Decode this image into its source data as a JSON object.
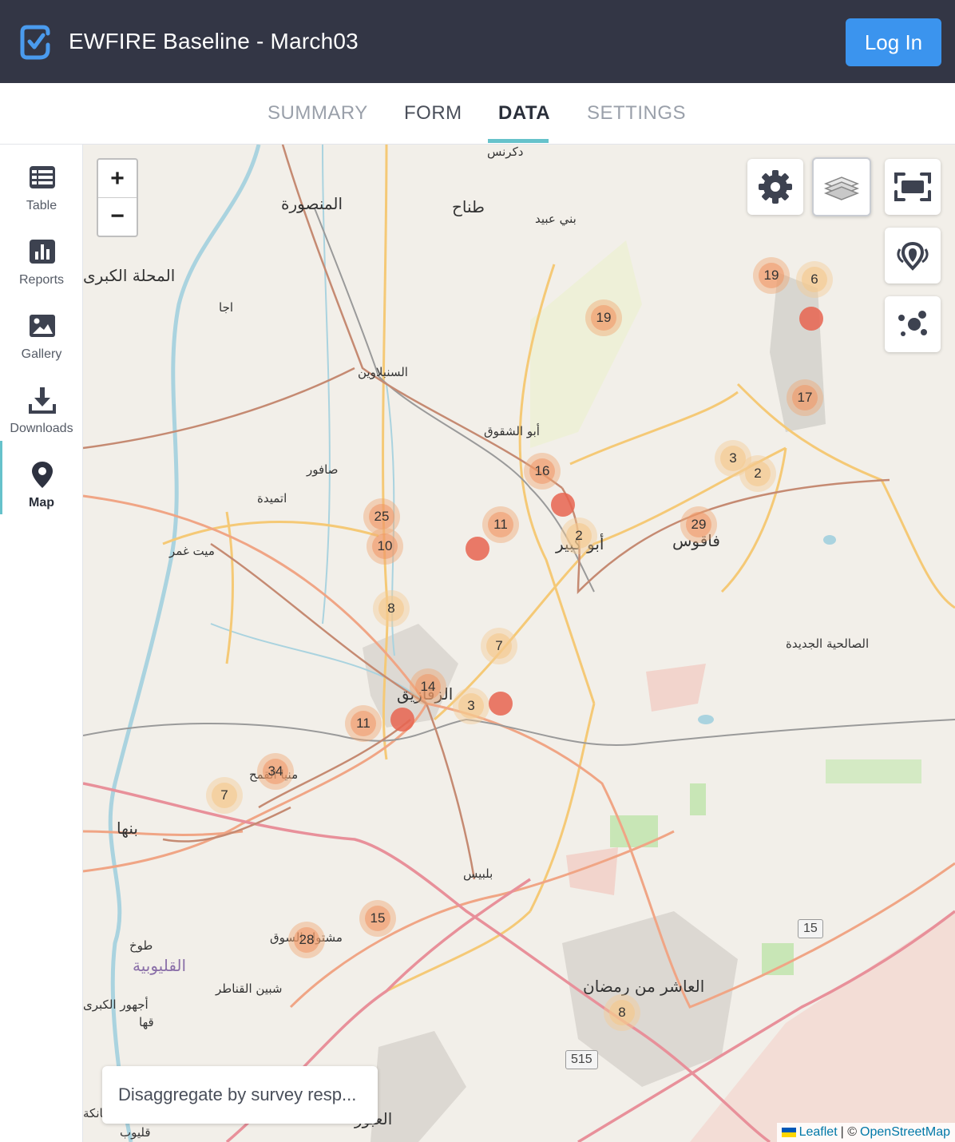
{
  "header": {
    "title": "EWFIRE Baseline - March03",
    "login_label": "Log In"
  },
  "tabs": [
    {
      "label": "SUMMARY"
    },
    {
      "label": "FORM"
    },
    {
      "label": "DATA"
    },
    {
      "label": "SETTINGS"
    }
  ],
  "sidebar": {
    "items": [
      {
        "label": "Table",
        "icon": "table-icon"
      },
      {
        "label": "Reports",
        "icon": "bar-chart-icon"
      },
      {
        "label": "Gallery",
        "icon": "image-icon"
      },
      {
        "label": "Downloads",
        "icon": "download-icon"
      },
      {
        "label": "Map",
        "icon": "map-pin-icon"
      }
    ]
  },
  "map": {
    "zoom_in": "+",
    "zoom_out": "−",
    "disaggregate_label": "Disaggregate by survey resp...",
    "attribution": {
      "leaflet": "Leaflet",
      "separator": "| ©",
      "osm": "OpenStreetMap"
    },
    "road_shields": [
      "15",
      "515"
    ],
    "places": [
      "دكرنس",
      "المنصورة",
      "طناح",
      "بني عبيد",
      "المحلة الكبرى",
      "اجا",
      "السنبلاوين",
      "أبو الشقوق",
      "صافور",
      "اتميدة",
      "ميت غمر",
      "أبو كبير",
      "فاقوس",
      "الصالحية الجديدة",
      "الزقازيق",
      "بلبيس",
      "مشتول السوق",
      "بنها",
      "طوخ",
      "القليوبية",
      "شبين القناطر",
      "أجهور الكبرى",
      "قها",
      "العاشر من رمضان",
      "منيا القمح",
      "قليوب",
      "الخانكة",
      "العبور"
    ],
    "clusters": [
      {
        "count": "19"
      },
      {
        "count": "6"
      },
      {
        "count": "19"
      },
      {
        "count": "17"
      },
      {
        "count": "3"
      },
      {
        "count": "2"
      },
      {
        "count": "16"
      },
      {
        "count": "25"
      },
      {
        "count": "11"
      },
      {
        "count": "10"
      },
      {
        "count": "2"
      },
      {
        "count": "29"
      },
      {
        "count": "8"
      },
      {
        "count": "7"
      },
      {
        "count": "14"
      },
      {
        "count": "3"
      },
      {
        "count": "11"
      },
      {
        "count": "34"
      },
      {
        "count": "7"
      },
      {
        "count": "15"
      },
      {
        "count": "28"
      },
      {
        "count": "8"
      }
    ],
    "single_markers": 5,
    "controls": [
      "gear-icon",
      "layers-icon",
      "fullscreen-icon",
      "heatmap-icon",
      "cluster-icon"
    ]
  },
  "colors": {
    "header_bg": "#333645",
    "accent": "#66c2cb",
    "login_bg": "#3b94ee",
    "cluster": "#f0a876",
    "marker": "#e86450"
  }
}
